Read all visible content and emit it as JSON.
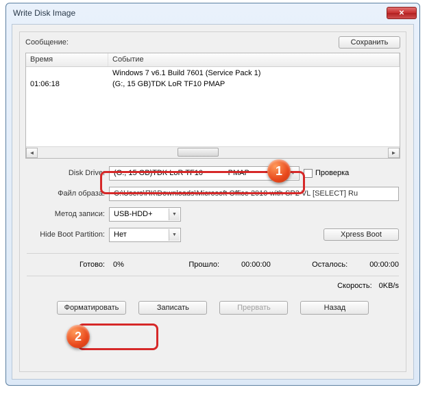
{
  "window": {
    "title": "Write Disk Image"
  },
  "topbar": {
    "message_label": "Сообщение:",
    "save_label": "Сохранить"
  },
  "listview": {
    "col_time": "Время",
    "col_event": "Событие",
    "rows": [
      {
        "time": "",
        "event": "Windows 7 v6.1 Build 7601 (Service Pack 1)"
      },
      {
        "time": "01:06:18",
        "event": "(G:, 15 GB)TDK LoR TF10            PMAP"
      }
    ]
  },
  "form": {
    "disk_drive_label": "Disk Drive:",
    "disk_drive_value": "(G:, 15 GB)TDK LoR TF10            PMAP",
    "check_label": "Проверка",
    "image_label": "Файл образа:",
    "image_value": "C:\\Users\\ПК\\Downloads\\Microsoft Office 2010 with SP2 VL [SELECT] Ru",
    "write_method_label": "Метод записи:",
    "write_method_value": "USB-HDD+",
    "hide_boot_label": "Hide Boot Partition:",
    "hide_boot_value": "Нет",
    "xpress_boot_label": "Xpress Boot"
  },
  "status": {
    "ready_label": "Готово:",
    "ready_value": "0%",
    "elapsed_label": "Прошло:",
    "elapsed_value": "00:00:00",
    "remaining_label": "Осталось:",
    "remaining_value": "00:00:00",
    "speed_label": "Скорость:",
    "speed_value": "0KB/s"
  },
  "buttons": {
    "format": "Форматировать",
    "write": "Записать",
    "abort": "Прервать",
    "back": "Назад"
  },
  "badges": {
    "one": "1",
    "two": "2"
  }
}
